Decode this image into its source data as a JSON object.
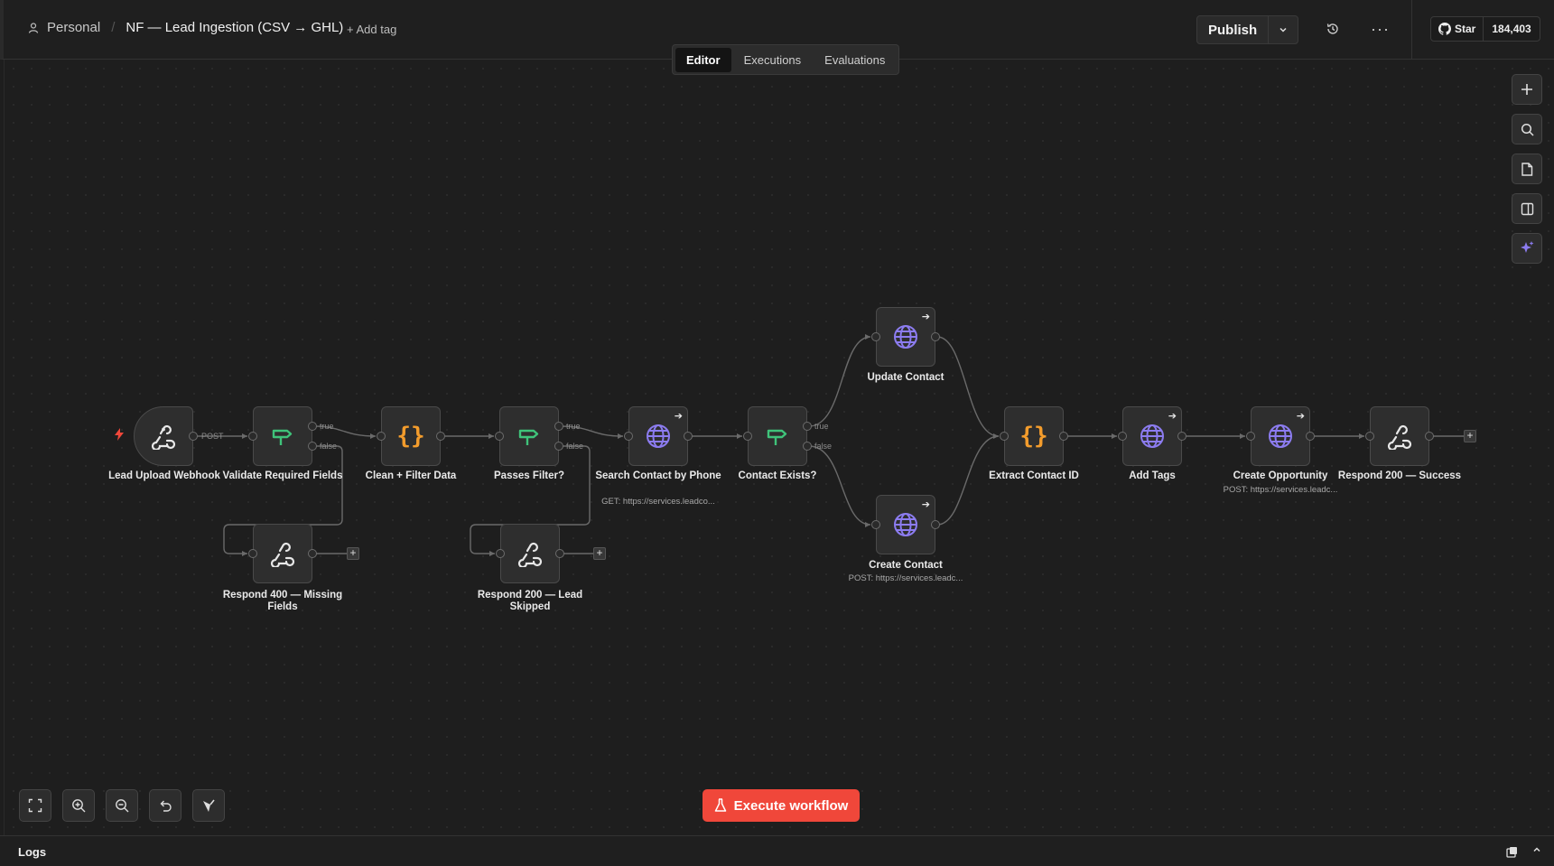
{
  "header": {
    "project": "Personal",
    "workflow_name": "NF — Lead Ingestion (CSV → GHL)",
    "add_tag": "+ Add tag",
    "publish_label": "Publish",
    "github_star": "Star",
    "github_count": "184,403"
  },
  "tabs": [
    {
      "label": "Editor",
      "active": true
    },
    {
      "label": "Executions",
      "active": false
    },
    {
      "label": "Evaluations",
      "active": false
    }
  ],
  "colors": {
    "accent": "#f0473a",
    "node_bg": "#2e2e2e",
    "webhook_icon": "#e8e8e8",
    "if_icon": "#3fc37a",
    "code_icon": "#f39c2c",
    "http_icon": "#8c7cf0"
  },
  "nodes": {
    "lead_upload_webhook": {
      "label": "Lead Upload Webhook",
      "icon": "webhook-icon"
    },
    "validate_required_fields": {
      "label": "Validate Required Fields",
      "icon": "if-icon"
    },
    "respond_400": {
      "label": "Respond 400 — Missing Fields",
      "icon": "webhook-icon"
    },
    "clean_filter": {
      "label": "Clean + Filter Data",
      "icon": "code-icon"
    },
    "passes_filter": {
      "label": "Passes Filter?",
      "icon": "if-icon"
    },
    "respond_200_skipped": {
      "label": "Respond 200 — Lead Skipped",
      "icon": "webhook-icon"
    },
    "search_contact": {
      "label": "Search Contact by Phone",
      "sub": "GET: https://services.leadco...",
      "icon": "globe-icon"
    },
    "contact_exists": {
      "label": "Contact Exists?",
      "icon": "if-icon"
    },
    "update_contact": {
      "label": "Update Contact",
      "icon": "globe-icon"
    },
    "create_contact": {
      "label": "Create Contact",
      "sub": "POST: https://services.leadc...",
      "icon": "globe-icon"
    },
    "extract_contact_id": {
      "label": "Extract Contact ID",
      "icon": "code-icon"
    },
    "add_tags": {
      "label": "Add Tags",
      "icon": "globe-icon"
    },
    "create_opportunity": {
      "label": "Create Opportunity",
      "sub": "POST: https://services.leadc...",
      "icon": "globe-icon"
    },
    "respond_200_success": {
      "label": "Respond 200 — Success",
      "icon": "webhook-icon"
    }
  },
  "edge_labels": {
    "post": "POST",
    "true": "true",
    "false": "false"
  },
  "execute_label": "Execute workflow",
  "logs": {
    "title": "Logs"
  }
}
